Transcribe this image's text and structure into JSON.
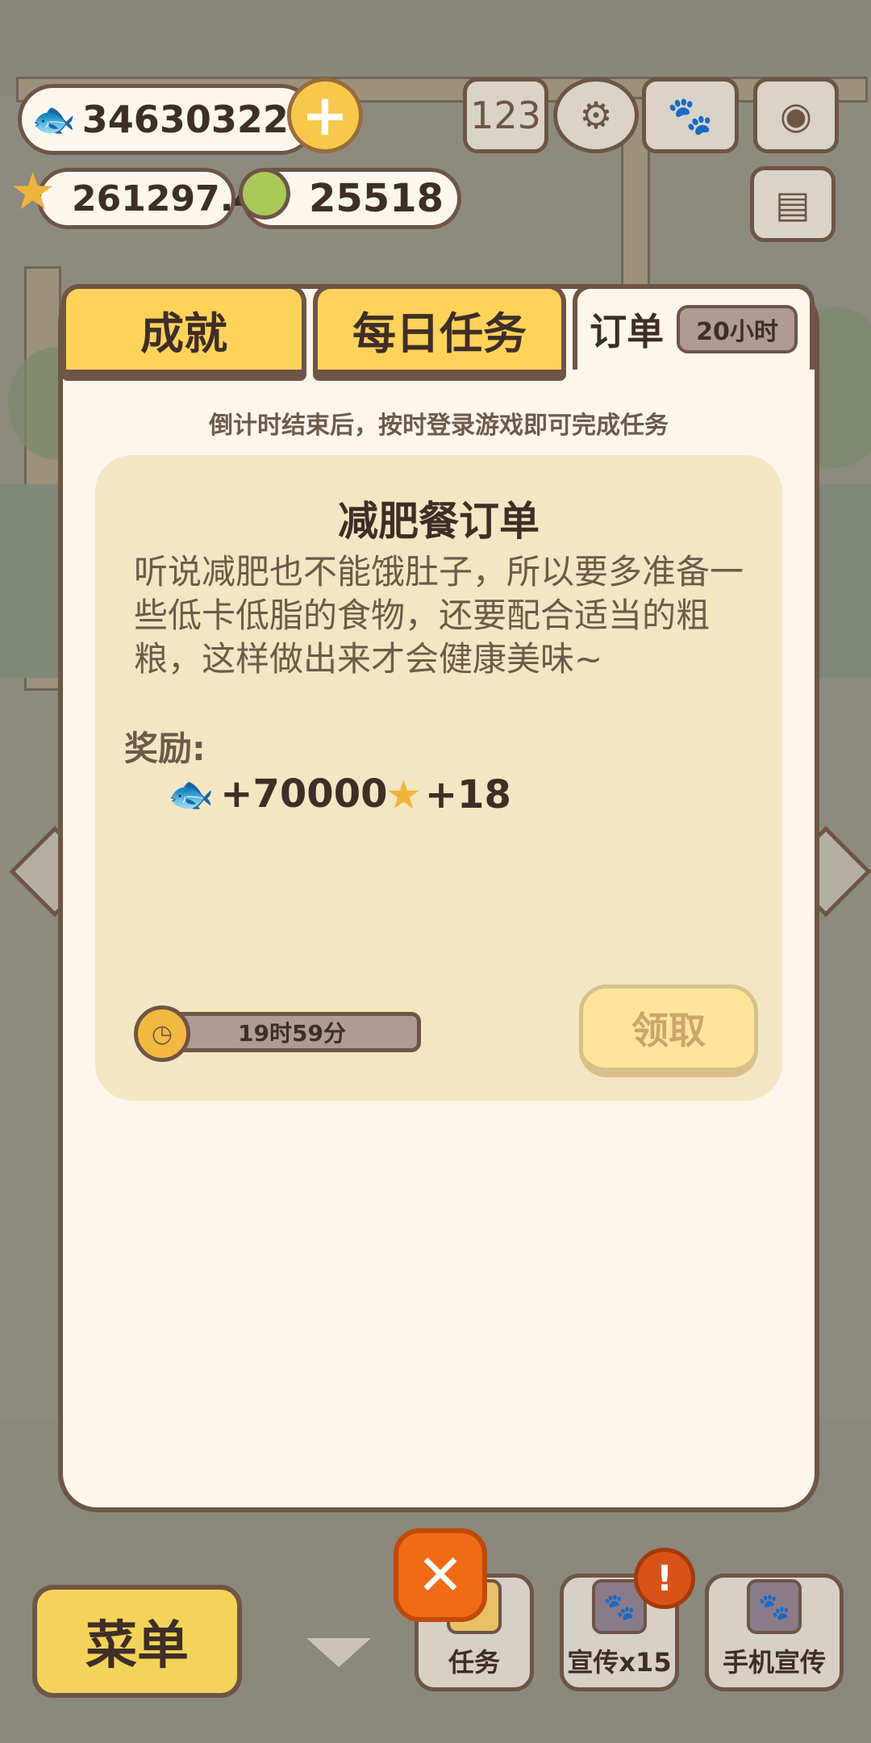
{
  "hud": {
    "fish_count": "346303221",
    "star_count": "261297.4",
    "coin_count": "25518",
    "add_label": "+"
  },
  "top_icons": [
    "ranking-icon",
    "settings-gear-icon",
    "paw-book-icon",
    "camera-icon",
    "newspaper-icon"
  ],
  "tabs": {
    "achievements": "成就",
    "daily": "每日任务",
    "orders": "订单",
    "orders_timer": "20小时"
  },
  "hint": "倒计时结束后，按时登录游戏即可完成任务",
  "order": {
    "title": "减肥餐订单",
    "description": "听说减肥也不能饿肚子，所以要多准备一些低卡低脂的食物，还要配合适当的粗粮，这样做出来才会健康美味~",
    "reward_label": "奖励:",
    "reward_fish": "+70000",
    "reward_star": "+18",
    "countdown": "19时59分",
    "claim_label": "领取"
  },
  "bottom": {
    "menu": "菜单",
    "tasks": "任务",
    "promo": "宣传x15",
    "phone_promo": "手机宣传",
    "alert": "!"
  },
  "colors": {
    "panel_bg": "#fdf6ec",
    "card_bg": "#f4e6c2",
    "tab_yellow": "#ffd25a",
    "border_brown": "#6e5545",
    "close_orange": "#f06b16"
  }
}
